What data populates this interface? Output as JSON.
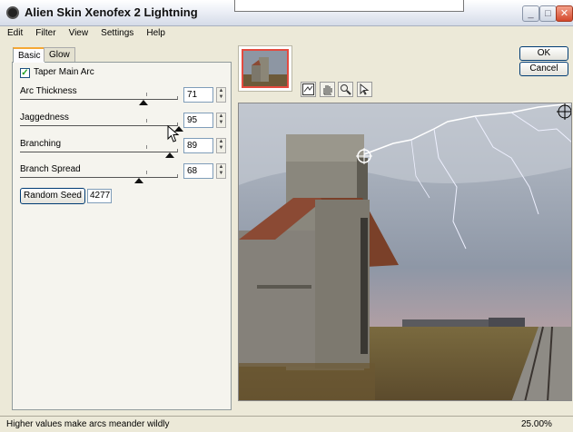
{
  "window": {
    "title": "Alien Skin Xenofex 2 Lightning"
  },
  "menu": [
    "Edit",
    "Filter",
    "View",
    "Settings",
    "Help"
  ],
  "tabs": [
    {
      "label": "Basic",
      "active": true
    },
    {
      "label": "Glow",
      "active": false
    }
  ],
  "taper": {
    "label": "Taper Main Arc",
    "checked": true,
    "check_glyph": "✓"
  },
  "params": [
    {
      "label": "Arc Thickness",
      "value": "71",
      "fraction": 0.71
    },
    {
      "label": "Jaggedness",
      "value": "95",
      "fraction": 0.95
    },
    {
      "label": "Branching",
      "value": "89",
      "fraction": 0.89
    },
    {
      "label": "Branch Spread",
      "value": "68",
      "fraction": 0.68
    }
  ],
  "seed": {
    "button_label": "Random Seed",
    "value": "4277"
  },
  "buttons": {
    "ok": "OK",
    "cancel": "Cancel"
  },
  "tools": [
    "preview-toggle-icon",
    "hand-icon",
    "zoom-icon",
    "pointer-icon"
  ],
  "status": {
    "text": "Higher values make arcs meander wildly",
    "zoom": "25.00%"
  },
  "colors": {
    "close_button": "#d4482c",
    "tab_accent": "#f5a835",
    "thumb_border": "#e44a3f",
    "check": "#21a121"
  },
  "spinner": {
    "up": "▲",
    "down": "▼"
  },
  "window_controls": {
    "minimize": "_",
    "maximize": "□",
    "close": "✕"
  }
}
